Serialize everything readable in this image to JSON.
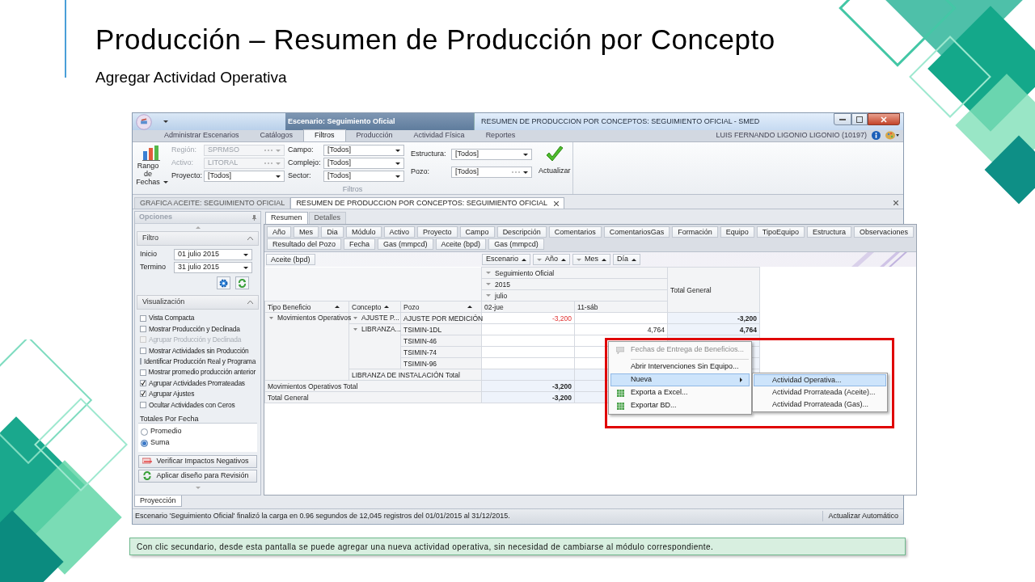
{
  "slide": {
    "title": "Producción – Resumen de Producción por Concepto",
    "subtitle": "Agregar Actividad Operativa",
    "caption": "Con clic secundario, desde esta pantalla se puede agregar una nueva actividad operativa, sin necesidad de cambiarse al módulo correspondiente."
  },
  "window": {
    "scenario": "Escenario: Seguimiento Oficial",
    "title": "RESUMEN DE PRODUCCION POR CONCEPTOS: SEGUIMIENTO OFICIAL - SMED",
    "user": "LUIS FERNANDO LIGONIO LIGONIO (10197)"
  },
  "ribbon_tabs": [
    {
      "label": "Administrar Escenarios",
      "selected": false
    },
    {
      "label": "Catálogos",
      "selected": false
    },
    {
      "label": "Filtros",
      "selected": true
    },
    {
      "label": "Producción",
      "selected": false
    },
    {
      "label": "Actividad Física",
      "selected": false
    },
    {
      "label": "Reportes",
      "selected": false
    }
  ],
  "ribbon": {
    "date_button": "Rango de Fechas",
    "update_button": "Actualizar",
    "group_label": "Filtros",
    "field_groups": [
      [
        {
          "label": "Región:",
          "value": "SPRMSO",
          "disabled": true,
          "ellipsis": true
        },
        {
          "label": "Activo:",
          "value": "LITORAL",
          "disabled": true,
          "ellipsis": true
        },
        {
          "label": "Proyecto:",
          "value": "[Todos]",
          "disabled": false,
          "ellipsis": false
        }
      ],
      [
        {
          "label": "Campo:",
          "value": "[Todos]",
          "disabled": false,
          "ellipsis": false
        },
        {
          "label": "Complejo:",
          "value": "[Todos]",
          "disabled": false,
          "ellipsis": false
        },
        {
          "label": "Sector:",
          "value": "[Todos]",
          "disabled": false,
          "ellipsis": false
        }
      ],
      [
        {
          "label": "Estructura:",
          "value": "[Todos]",
          "disabled": false,
          "ellipsis": false
        },
        {
          "label": "Pozo:",
          "value": "[Todos]",
          "disabled": false,
          "ellipsis": true
        }
      ]
    ]
  },
  "document_tabs": [
    {
      "label": "GRAFICA ACEITE: SEGUIMIENTO OFICIAL",
      "selected": false
    },
    {
      "label": "RESUMEN DE PRODUCCION POR CONCEPTOS: SEGUIMIENTO OFICIAL",
      "selected": true
    }
  ],
  "options_panel": {
    "title": "Opciones",
    "filter": {
      "title": "Filtro",
      "expanded": true,
      "dates": [
        {
          "label": "Inicio",
          "value": "01 julio 2015"
        },
        {
          "label": "Termino",
          "value": "31 julio 2015"
        }
      ]
    },
    "visualization": {
      "title": "Visualización",
      "expanded": true,
      "options": [
        {
          "label": "Vista Compacta",
          "checked": false,
          "disabled": false
        },
        {
          "label": "Mostrar Producción y Declinada",
          "checked": false,
          "disabled": false
        },
        {
          "label": "Agrupar Producción y Declinada",
          "checked": false,
          "disabled": true
        },
        {
          "label": "Mostrar Actividades sin Producción",
          "checked": false,
          "disabled": false
        },
        {
          "label": "Identificar Producción Real y Programa",
          "checked": false,
          "disabled": false
        },
        {
          "label": "Mostrar promedio producción anterior",
          "checked": false,
          "disabled": false
        },
        {
          "label": "Agrupar Actividades Prorrateadas",
          "checked": true,
          "disabled": false
        },
        {
          "label": "Agrupar Ajustes",
          "checked": true,
          "disabled": false
        },
        {
          "label": "Ocultar Actividades con Ceros",
          "checked": false,
          "disabled": false
        }
      ],
      "totals_label": "Totales Por Fecha",
      "totals": [
        {
          "label": "Promedio",
          "selected": false
        },
        {
          "label": "Suma",
          "selected": true
        }
      ]
    },
    "buttons": [
      {
        "label": "Verificar Impactos Negativos",
        "kind": "negative"
      },
      {
        "label": "Aplicar diseño para Revisión",
        "kind": "refresh"
      }
    ]
  },
  "view_tabs": [
    {
      "label": "Resumen",
      "selected": true
    },
    {
      "label": "Detalles",
      "selected": false
    }
  ],
  "filter_fields": [
    [
      "Año",
      "Mes",
      "Dia",
      "Módulo",
      "Activo",
      "Proyecto",
      "Campo",
      "Descripción",
      "Comentarios",
      "ComentariosGas",
      "Formación",
      "Equipo",
      "TipoEquipo",
      "Estructura",
      "Observaciones"
    ],
    [
      "Resultado del Pozo",
      "Fecha",
      "Gas (mmpcd)",
      "Aceite (bpd)",
      "Gas (mmpcd)"
    ]
  ],
  "pivot": {
    "data_field": "Aceite (bpd)",
    "column_fields": [
      {
        "label": "Escenario",
        "collapsible": false
      },
      {
        "label": "Año",
        "collapsible": true
      },
      {
        "label": "Mes",
        "collapsible": true
      },
      {
        "label": "Día",
        "collapsible": false
      }
    ],
    "column_levels": [
      "Seguimiento Oficial",
      "2015",
      "julio"
    ],
    "dates": [
      "02-jue",
      "11-sáb"
    ],
    "total_header": "Total General",
    "row_fields": [
      "Tipo Beneficio",
      "Concepto",
      "Pozo"
    ],
    "row_groups": [
      {
        "label": "Movimientos Operativos",
        "expanded": true,
        "children": [
          {
            "label": "AJUSTE P...",
            "expanded": true,
            "children": [
              {
                "label": "AJUSTE POR MEDICIÓN",
                "values": {
                  "date_1": {
                    "text": "-3,200",
                    "negative": true
                  },
                  "total": {
                    "text": "-3,200",
                    "negative": false
                  }
                }
              }
            ]
          },
          {
            "label": "LIBRANZA...",
            "expanded": true,
            "children": [
              {
                "label": "TSIMIN-1DL",
                "values": {
                  "date_2": {
                    "text": "4,764",
                    "negative": false
                  },
                  "total": {
                    "text": "4,764",
                    "negative": false
                  }
                }
              },
              {
                "label": "TSIMIN-46"
              },
              {
                "label": "TSIMIN-74"
              },
              {
                "label": "TSIMIN-96"
              }
            ],
            "total": {
              "label": "LIBRANZA DE INSTALACIÓN Total"
            }
          }
        ],
        "total": {
          "label": "Movimientos Operativos Total",
          "values": {
            "date_1": {
              "text": "-3,200",
              "negative": false
            }
          }
        }
      }
    ],
    "grand_total": {
      "label": "Total General",
      "values": {
        "date_1": {
          "text": "-3,200",
          "negative": false
        }
      }
    }
  },
  "context_menu": {
    "items": [
      {
        "label": "Fechas de Entrega de Beneficios...",
        "disabled": true,
        "selected": false,
        "kind": "note",
        "separator_before": false,
        "has_submenu": false
      },
      {
        "label": "Abrir Intervenciones Sin Equipo...",
        "disabled": false,
        "selected": false,
        "kind": "plain",
        "separator_before": true,
        "has_submenu": false
      },
      {
        "label": "Nueva",
        "disabled": false,
        "selected": true,
        "kind": "plain",
        "separator_before": false,
        "has_submenu": true
      },
      {
        "label": "Exporta a Excel...",
        "disabled": false,
        "selected": false,
        "kind": "sheet",
        "separator_before": false,
        "has_submenu": false
      },
      {
        "label": "Exportar BD...",
        "disabled": false,
        "selected": false,
        "kind": "sheet",
        "separator_before": false,
        "has_submenu": false
      }
    ],
    "submenu": [
      {
        "label": "Actividad Operativa...",
        "selected": true
      },
      {
        "label": "Actividad Prorrateada (Aceite)...",
        "selected": false
      },
      {
        "label": "Actividad Prorrateada (Gas)...",
        "selected": false
      }
    ]
  },
  "bottom_tabs": [
    {
      "label": "Proyección",
      "selected": true
    }
  ],
  "status_bar": {
    "message": "Escenario 'Seguimiento Oficial' finalizó la carga en 0.96 segundos de 12,045 registros del 01/01/2015 al 31/12/2015.",
    "right": "Actualizar Automático"
  }
}
